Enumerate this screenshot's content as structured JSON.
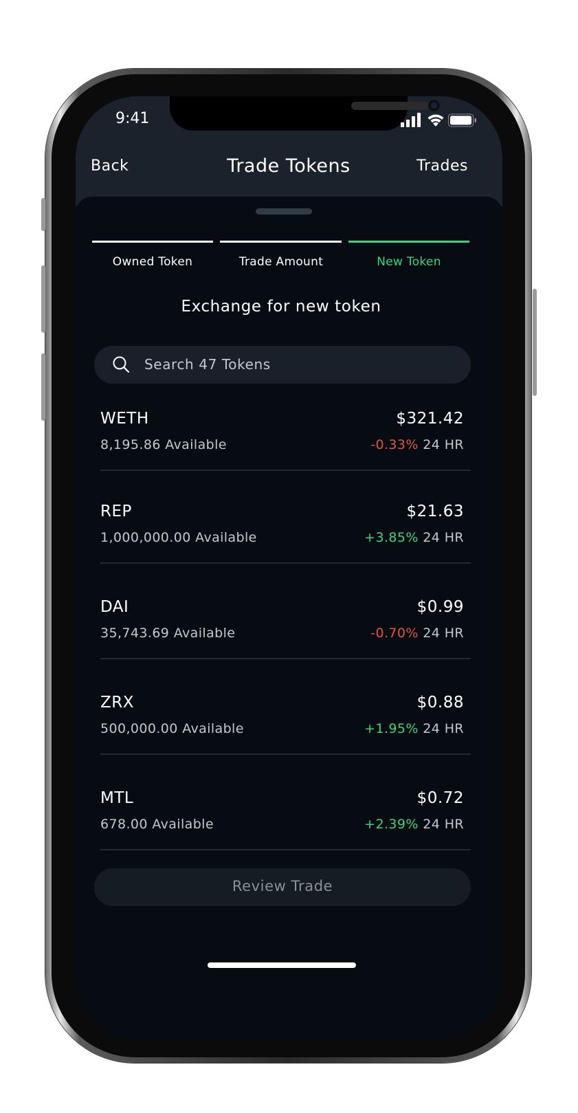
{
  "status_bar": {
    "time": "9:41"
  },
  "nav": {
    "back_label": "Back",
    "title": "Trade Tokens",
    "trades_label": "Trades"
  },
  "steps": [
    {
      "label": "Owned Token",
      "state": "done"
    },
    {
      "label": "Trade Amount",
      "state": "done"
    },
    {
      "label": "New Token",
      "state": "active"
    }
  ],
  "section_title": "Exchange for new token",
  "search": {
    "placeholder": "Search 47 Tokens"
  },
  "tokens": [
    {
      "symbol": "WETH",
      "available": "8,195.86 Available",
      "price": "$321.42",
      "change": "-0.33%",
      "direction": "negative",
      "period": "24 HR"
    },
    {
      "symbol": "REP",
      "available": "1,000,000.00 Available",
      "price": "$21.63",
      "change": "+3.85%",
      "direction": "positive",
      "period": "24 HR"
    },
    {
      "symbol": "DAI",
      "available": "35,743.69 Available",
      "price": "$0.99",
      "change": "-0.70%",
      "direction": "negative",
      "period": "24 HR"
    },
    {
      "symbol": "ZRX",
      "available": "500,000.00 Available",
      "price": "$0.88",
      "change": "+1.95%",
      "direction": "positive",
      "period": "24 HR"
    },
    {
      "symbol": "MTL",
      "available": "678.00 Available",
      "price": "$0.72",
      "change": "+2.39%",
      "direction": "positive",
      "period": "24 HR"
    }
  ],
  "review_button": {
    "label": "Review Trade"
  },
  "colors": {
    "accent": "#3ad483",
    "negative": "#e2553f",
    "background": "#070c12",
    "header": "#1b222b"
  }
}
